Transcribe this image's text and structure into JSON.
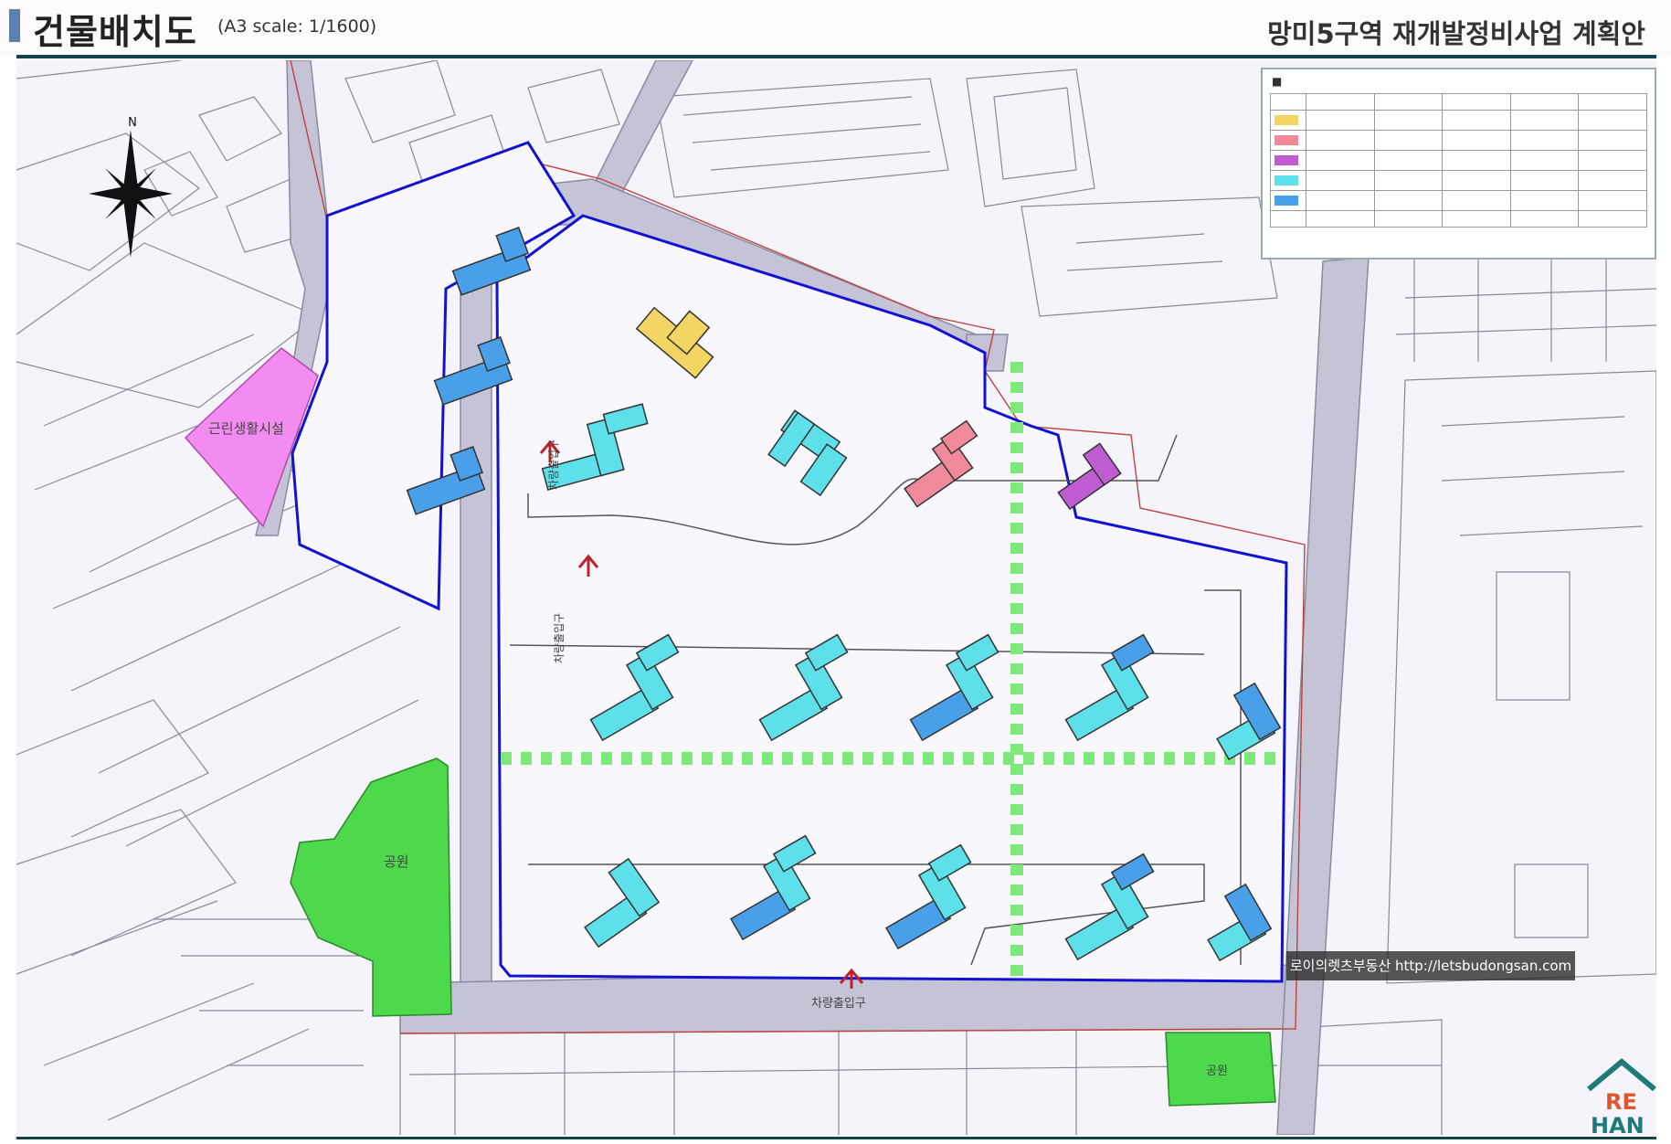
{
  "header": {
    "title": "건물배치도",
    "scale": "(A3 scale: 1/1600)",
    "plan_title": "망미5구역 재개발정비사업 계획안"
  },
  "map": {
    "north_label": "N",
    "labels": {
      "welfare": "근린생활시설",
      "park": "공원",
      "small_park": "공원",
      "entrance_main": "차량출입구",
      "entrance_west_1": "차량출입구",
      "entrance_west_2": "차량출입구"
    },
    "colors": {
      "yellow": "#f2d562",
      "pink": "#f08a9a",
      "purple": "#c05cd2",
      "cyan": "#5de0ea",
      "blue": "#4aa0e8",
      "welfare": "#f38cf0",
      "park": "#4ed84c",
      "boundary": "#1212d0",
      "road": "#c4c4d6",
      "axis": "#7ee87a"
    },
    "watermark": "로이의렛츠부동산 http://letsbudongsan.com",
    "logo_text": [
      "RE",
      "HAN"
    ]
  }
}
